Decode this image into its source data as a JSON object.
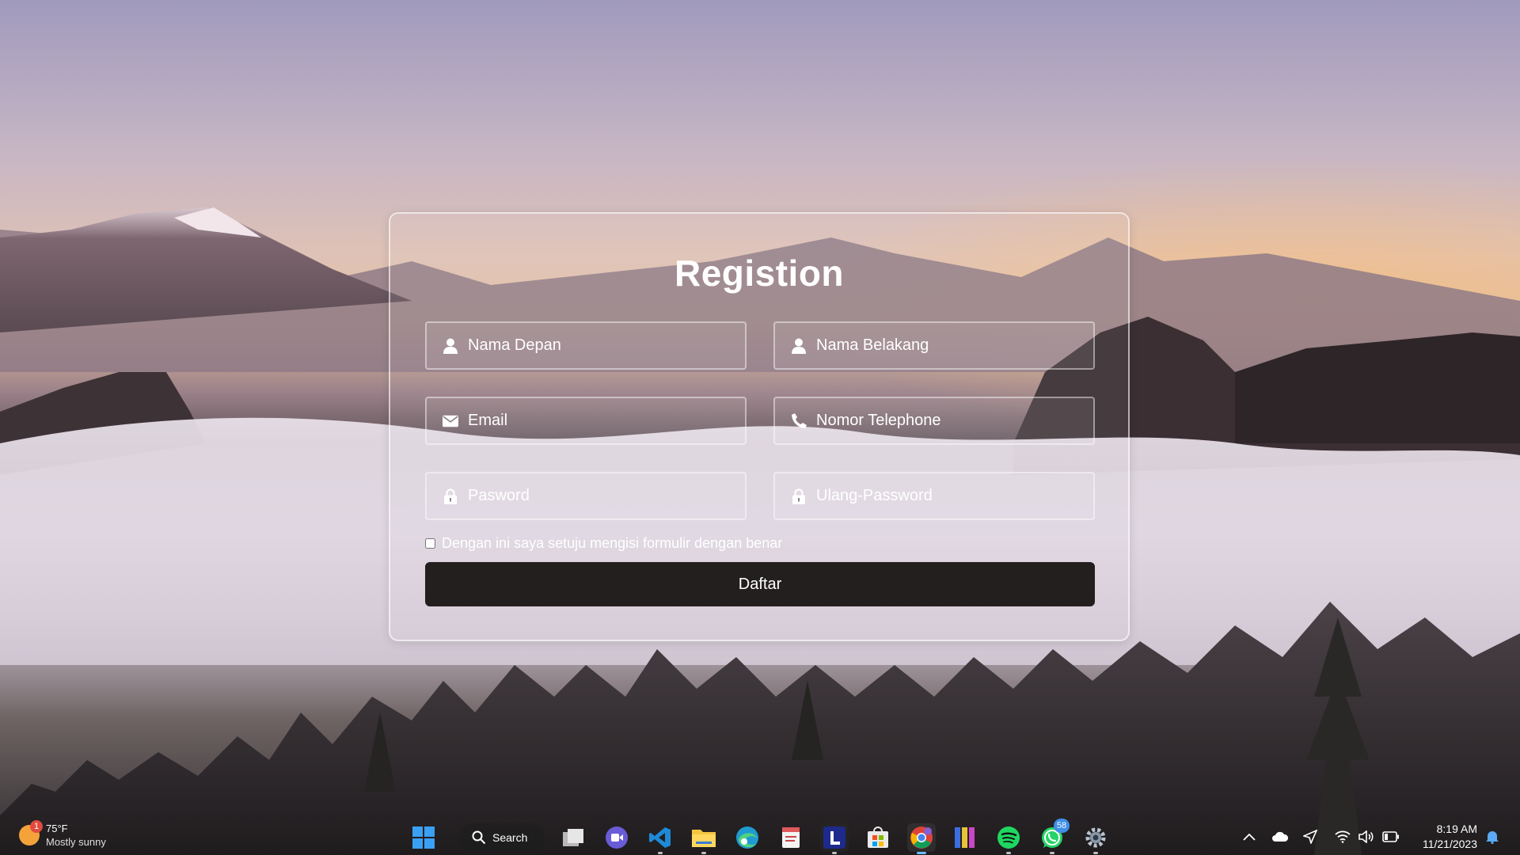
{
  "form": {
    "title": "Registion",
    "first_name_placeholder": "Nama Depan",
    "last_name_placeholder": "Nama Belakang",
    "email_placeholder": "Email",
    "phone_placeholder": "Nomor Telephone",
    "password_placeholder": "Pasword",
    "confirm_password_placeholder": "Ulang-Password",
    "agree_label": "Dengan ini saya setuju mengisi formulir dengan benar",
    "agree_checked": false,
    "submit_label": "Daftar",
    "button_color": "#231f1f"
  },
  "taskbar": {
    "weather": {
      "temp": "75°F",
      "condition": "Mostly sunny",
      "badge": "1"
    },
    "search_label": "Search",
    "apps": [
      {
        "name": "start",
        "icon": "windows-logo-icon"
      },
      {
        "name": "search",
        "icon": "search-icon"
      },
      {
        "name": "task-view",
        "icon": "task-view-icon"
      },
      {
        "name": "teams-meet",
        "icon": "video-call-icon"
      },
      {
        "name": "vscode",
        "icon": "vscode-icon"
      },
      {
        "name": "file-explorer",
        "icon": "folder-icon"
      },
      {
        "name": "edge",
        "icon": "edge-icon"
      },
      {
        "name": "notes-app",
        "icon": "notes-icon"
      },
      {
        "name": "launcher-l",
        "icon": "l-app-icon"
      },
      {
        "name": "store",
        "icon": "store-icon"
      },
      {
        "name": "chrome",
        "icon": "chrome-icon",
        "active": true
      },
      {
        "name": "winrar",
        "icon": "books-icon"
      },
      {
        "name": "spotify",
        "icon": "spotify-icon"
      },
      {
        "name": "whatsapp",
        "icon": "whatsapp-icon",
        "badge": "58"
      },
      {
        "name": "settings",
        "icon": "settings-icon"
      }
    ],
    "clock": {
      "time": "8:19 AM",
      "date": "11/21/2023"
    }
  }
}
